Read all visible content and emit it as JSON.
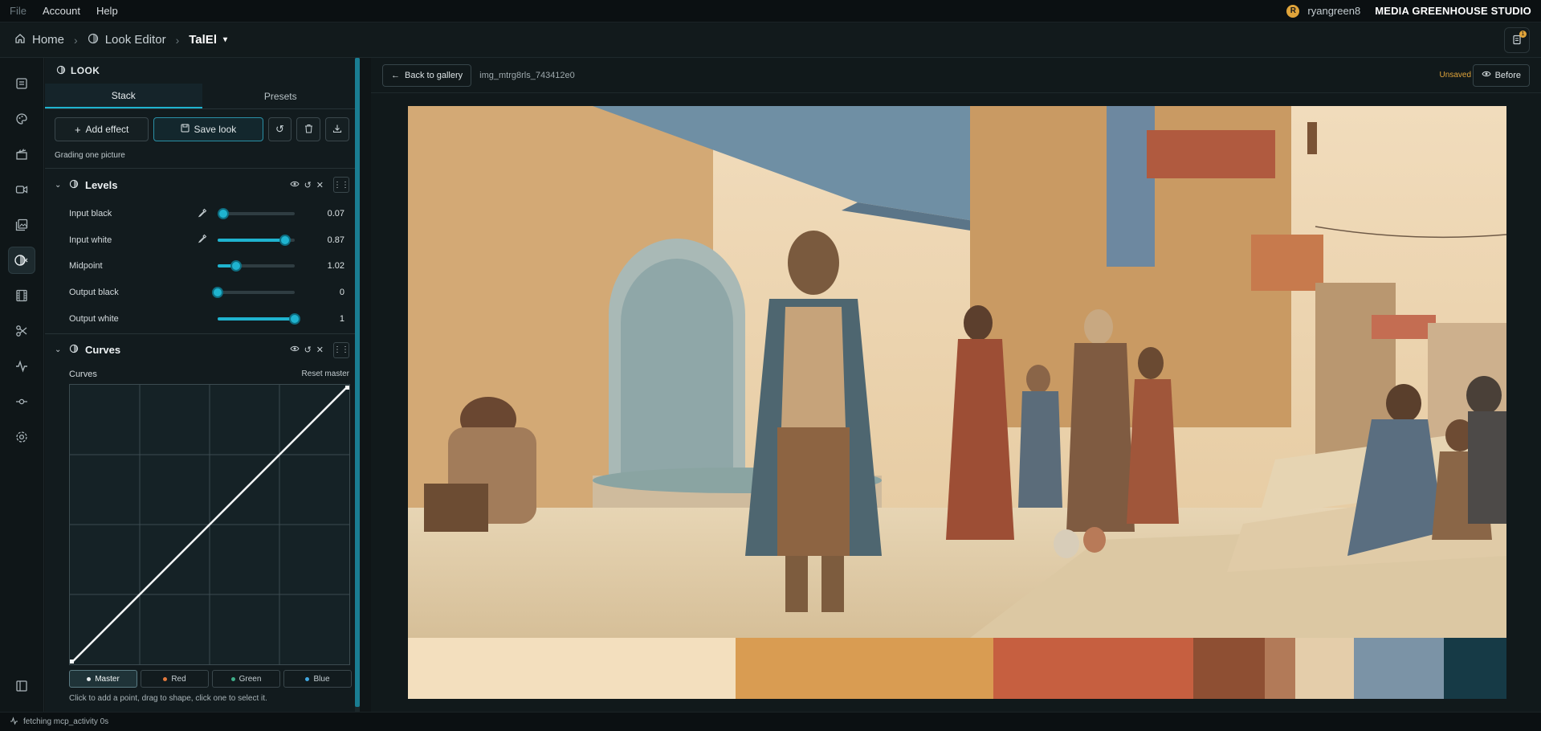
{
  "menubar": {
    "items": [
      "File",
      "Account",
      "Help"
    ],
    "user_initial": "R",
    "username": "ryangreen8",
    "studio": "MEDIA GREENHOUSE STUDIO"
  },
  "breadcrumb": {
    "home": "Home",
    "look_editor": "Look Editor",
    "current": "TalEl",
    "notif_count": "1"
  },
  "panel": {
    "title": "LOOK",
    "tabs": [
      "Stack",
      "Presets"
    ],
    "add_effect": "Add effect",
    "save_look": "Save look",
    "hint": "Grading one picture",
    "levels": {
      "title": "Levels",
      "rows": [
        {
          "label": "Input black",
          "value": "0.07",
          "level": 0.07,
          "picker": true
        },
        {
          "label": "Input white",
          "value": "0.87",
          "level": 0.87,
          "picker": true
        },
        {
          "label": "Midpoint",
          "value": "1.02",
          "level": 0.24,
          "picker": false
        },
        {
          "label": "Output black",
          "value": "0",
          "level": 0.0,
          "picker": false
        },
        {
          "label": "Output white",
          "value": "1",
          "level": 1.0,
          "picker": false
        }
      ]
    },
    "curves": {
      "title": "Curves",
      "label": "Curves",
      "reset": "Reset master",
      "channels": [
        {
          "label": "Master",
          "color": "#e6ecee"
        },
        {
          "label": "Red",
          "color": "#e2793d"
        },
        {
          "label": "Green",
          "color": "#3fae8a"
        },
        {
          "label": "Blue",
          "color": "#41a7e0"
        }
      ],
      "hint": "Click to add a point, drag to shape, click one to select it."
    }
  },
  "main": {
    "back": "Back to gallery",
    "image_id": "img_mtrg8rls_743412e0",
    "unsaved": "Unsaved",
    "before": "Before",
    "swatches": [
      {
        "color": "#f3dfbe",
        "weight": 0.298
      },
      {
        "color": "#d99c52",
        "weight": 0.235
      },
      {
        "color": "#c65f40",
        "weight": 0.182
      },
      {
        "color": "#8e4f33",
        "weight": 0.065
      },
      {
        "color": "#b27a58",
        "weight": 0.028
      },
      {
        "color": "#e4cdaa",
        "weight": 0.053
      },
      {
        "color": "#7b93a6",
        "weight": 0.082
      },
      {
        "color": "#163a46",
        "weight": 0.057
      }
    ]
  },
  "status": {
    "text": "fetching mcp_activity 0s"
  },
  "colors": {
    "accent": "#1fb3cf",
    "warning": "#e0a43a"
  }
}
